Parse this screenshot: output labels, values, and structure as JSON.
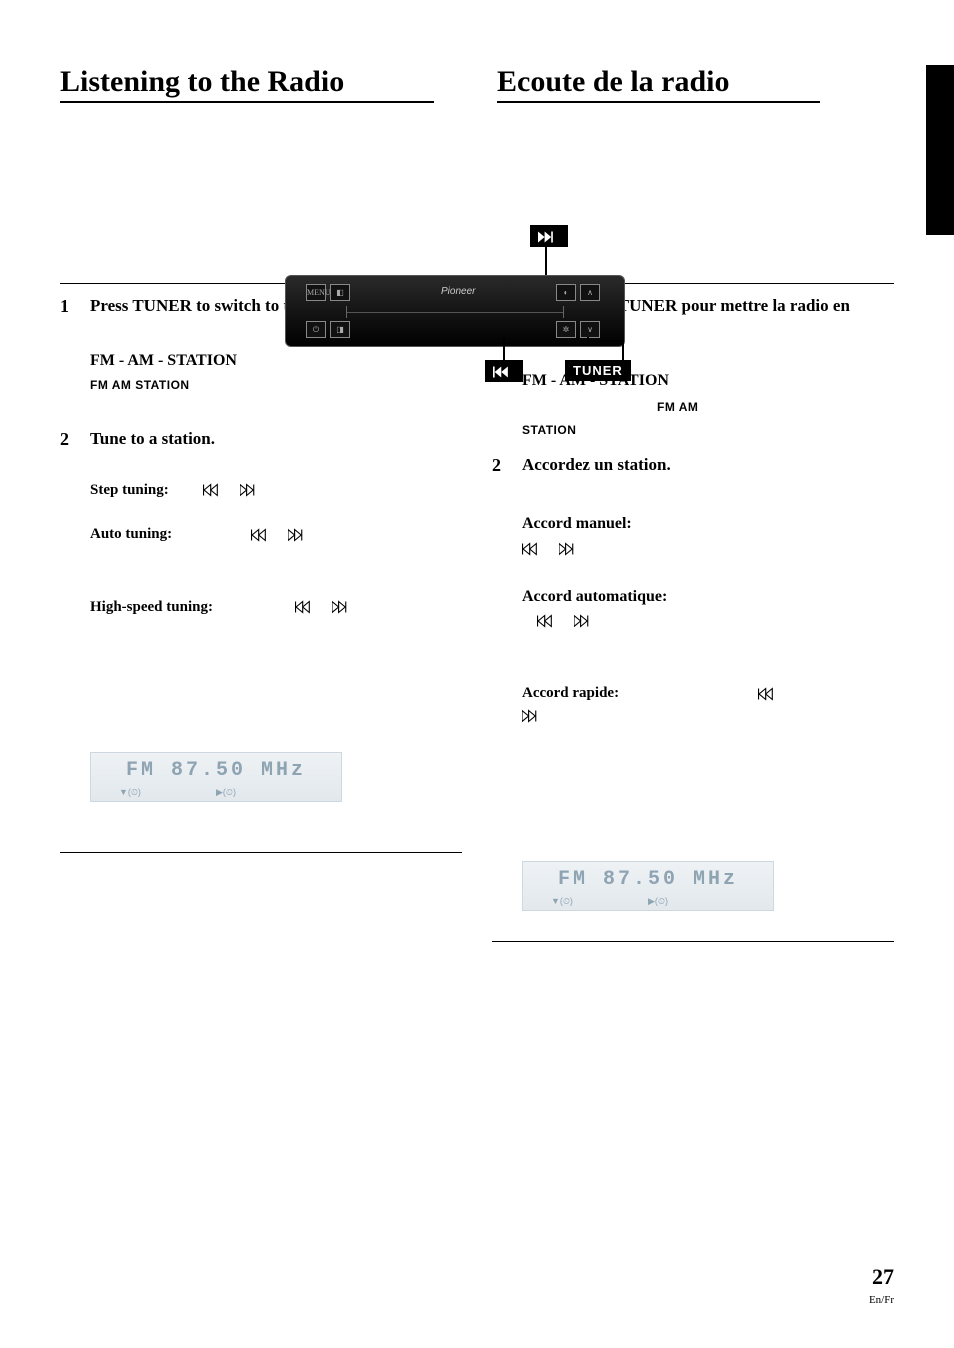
{
  "titles": {
    "left": "Listening to the Radio",
    "right": "Ecoute de la radio"
  },
  "device": {
    "brand": "Pioneer",
    "callouts": {
      "forward": "▶▶",
      "previous": "◀◀",
      "tuner": "TUNER"
    }
  },
  "left_col": {
    "step1": {
      "num": "1",
      "title": "Press TUNER to switch to tuner mode.",
      "sub": "FM - AM - STATION",
      "caps": "FM    AM       STATION"
    },
    "step2": {
      "num": "2",
      "title": "Tune to a station.",
      "step_tuning": "Step tuning:",
      "auto_tuning": "Auto tuning:",
      "high_speed": "High-speed tuning:"
    },
    "display": {
      "text": "FM   87.50 MHz"
    }
  },
  "right_col": {
    "step1": {
      "num": "1",
      "title": "Appuyez sur TUNER pour mettre la radio en service.",
      "sub": "FM - AM - STATION",
      "caps1": "FM    AM",
      "caps2": "STATION"
    },
    "step2": {
      "num": "2",
      "title": "Accordez un station.",
      "manual": "Accord manuel:",
      "auto": "Accord automatique:",
      "rapid": "Accord rapide:"
    },
    "display": {
      "text": "FM   87.50 MHz"
    }
  },
  "page": {
    "number": "27",
    "lang": "En/Fr"
  },
  "icons": {
    "prev": "prev-icon",
    "next": "next-icon",
    "timer": "▼(⏲)",
    "play": "▶(⏲)"
  }
}
